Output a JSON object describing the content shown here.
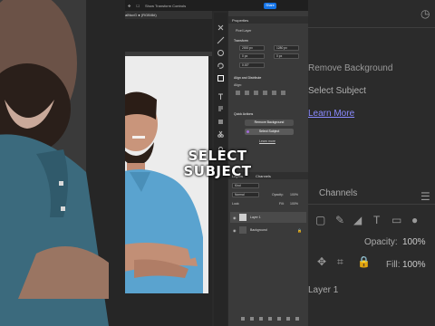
{
  "caption": {
    "line1": "SELECT",
    "line2": "SUBJECT"
  },
  "app": {
    "doc_tab": "alNsvG ● (RGB/8#)",
    "menu_title": "Show Transform Controls",
    "share_label": "Share"
  },
  "properties": {
    "header": "Properties",
    "pixel_layer_label": "Pixel Layer",
    "transform_label": "Transform",
    "w_value": "2000 px",
    "h_value": "1280 px",
    "x_value": "0 px",
    "y_value": "0 px",
    "angle_value": "0.00°",
    "align_label": "Align and Distribute",
    "align_sub": "Align:",
    "quick_actions_label": "Quick Actions",
    "remove_bg_label": "Remove Background",
    "select_subject_label": "Select Subject",
    "learn_more_label": "Learn more"
  },
  "layers": {
    "tab_layers": "Layers",
    "tab_channels": "Channels",
    "kind_label": "Kind",
    "blend_mode": "Normal",
    "opacity_label": "Opacity:",
    "opacity_value": "100%",
    "lock_label": "Lock:",
    "fill_label": "Fill:",
    "fill_value": "100%",
    "rows": [
      {
        "name": "Layer 1"
      },
      {
        "name": "Background"
      }
    ]
  },
  "right_zoom": {
    "remove_bg": "Remove Background",
    "select_subject": "Select Subject",
    "learn_more": "Learn More",
    "channels": "Channels",
    "opacity_label": "Opacity:",
    "opacity_value": "100%",
    "fill_label": "Fill:",
    "fill_value": "100%",
    "layer_name": "Layer 1"
  }
}
